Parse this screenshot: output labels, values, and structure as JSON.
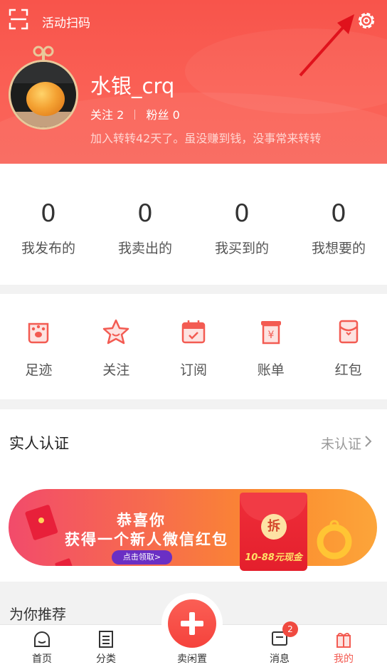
{
  "header": {
    "scan_label": "活动扫码",
    "username": "水银_crq",
    "following_label": "关注",
    "following_count": "2",
    "fans_label": "粉丝",
    "fans_count": "0",
    "bio": "加入转转42天了。虽没赚到钱，没事常来转转"
  },
  "stats": [
    {
      "num": "0",
      "label": "我发布的"
    },
    {
      "num": "0",
      "label": "我卖出的"
    },
    {
      "num": "0",
      "label": "我买到的"
    },
    {
      "num": "0",
      "label": "我想要的"
    }
  ],
  "tools": [
    {
      "label": "足迹",
      "icon": "paw-icon"
    },
    {
      "label": "关注",
      "icon": "star-icon"
    },
    {
      "label": "订阅",
      "icon": "calendar-icon"
    },
    {
      "label": "账单",
      "icon": "bill-icon"
    },
    {
      "label": "红包",
      "icon": "red-envelope-icon"
    }
  ],
  "verify": {
    "title": "实人认证",
    "status": "未认证"
  },
  "banner": {
    "line1": "恭喜你",
    "line2": "获得一个新人微信红包",
    "button": "点击领取>",
    "coin": "拆",
    "amount": "10-88元现金"
  },
  "recommend_label": "为你推荐",
  "tabbar": {
    "home": "首页",
    "category": "分类",
    "sell": "卖闲置",
    "messages": "消息",
    "mine": "我的",
    "badge": "2"
  },
  "colors": {
    "accent": "#f8544b",
    "text": "#333333",
    "muted": "#999999"
  }
}
